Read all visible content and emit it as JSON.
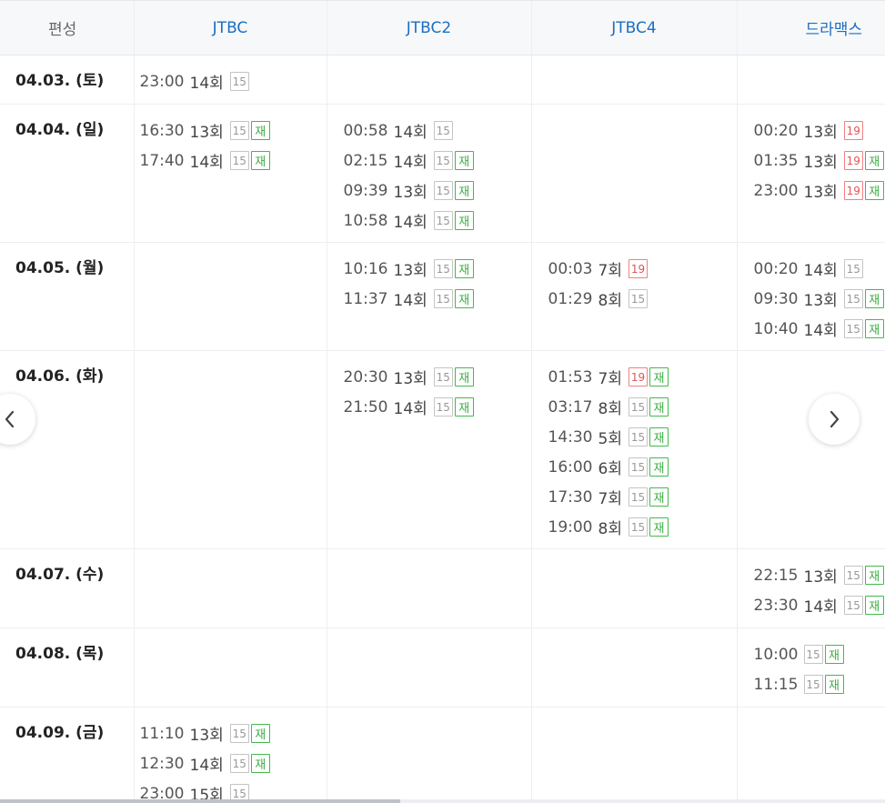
{
  "header": {
    "date_col": "편성",
    "channels": [
      "JTBC",
      "JTBC2",
      "JTBC4",
      "드라맥스"
    ]
  },
  "rows": [
    {
      "date": "04.03. (토)",
      "cells": [
        [
          {
            "time": "23:00",
            "ep": "14회",
            "rating": "15",
            "rerun": false
          }
        ],
        [],
        [],
        []
      ]
    },
    {
      "date": "04.04. (일)",
      "cells": [
        [
          {
            "time": "16:30",
            "ep": "13회",
            "rating": "15",
            "rerun": true
          },
          {
            "time": "17:40",
            "ep": "14회",
            "rating": "15",
            "rerun": true
          }
        ],
        [
          {
            "time": "00:58",
            "ep": "14회",
            "rating": "15",
            "rerun": false
          },
          {
            "time": "02:15",
            "ep": "14회",
            "rating": "15",
            "rerun": true
          },
          {
            "time": "09:39",
            "ep": "13회",
            "rating": "15",
            "rerun": true
          },
          {
            "time": "10:58",
            "ep": "14회",
            "rating": "15",
            "rerun": true
          }
        ],
        [],
        [
          {
            "time": "00:20",
            "ep": "13회",
            "rating": "19",
            "rerun": false
          },
          {
            "time": "01:35",
            "ep": "13회",
            "rating": "19",
            "rerun": true
          },
          {
            "time": "23:00",
            "ep": "13회",
            "rating": "19",
            "rerun": true
          }
        ]
      ]
    },
    {
      "date": "04.05. (월)",
      "cells": [
        [],
        [
          {
            "time": "10:16",
            "ep": "13회",
            "rating": "15",
            "rerun": true
          },
          {
            "time": "11:37",
            "ep": "14회",
            "rating": "15",
            "rerun": true
          }
        ],
        [
          {
            "time": "00:03",
            "ep": "7회",
            "rating": "19",
            "rerun": false
          },
          {
            "time": "01:29",
            "ep": "8회",
            "rating": "15",
            "rerun": false
          }
        ],
        [
          {
            "time": "00:20",
            "ep": "14회",
            "rating": "15",
            "rerun": false
          },
          {
            "time": "09:30",
            "ep": "13회",
            "rating": "15",
            "rerun": true
          },
          {
            "time": "10:40",
            "ep": "14회",
            "rating": "15",
            "rerun": true
          }
        ]
      ]
    },
    {
      "date": "04.06. (화)",
      "cells": [
        [],
        [
          {
            "time": "20:30",
            "ep": "13회",
            "rating": "15",
            "rerun": true
          },
          {
            "time": "21:50",
            "ep": "14회",
            "rating": "15",
            "rerun": true
          }
        ],
        [
          {
            "time": "01:53",
            "ep": "7회",
            "rating": "19",
            "rerun": true
          },
          {
            "time": "03:17",
            "ep": "8회",
            "rating": "15",
            "rerun": true
          },
          {
            "time": "14:30",
            "ep": "5회",
            "rating": "15",
            "rerun": true
          },
          {
            "time": "16:00",
            "ep": "6회",
            "rating": "15",
            "rerun": true
          },
          {
            "time": "17:30",
            "ep": "7회",
            "rating": "15",
            "rerun": true
          },
          {
            "time": "19:00",
            "ep": "8회",
            "rating": "15",
            "rerun": true
          }
        ],
        []
      ]
    },
    {
      "date": "04.07. (수)",
      "cells": [
        [],
        [],
        [],
        [
          {
            "time": "22:15",
            "ep": "13회",
            "rating": "15",
            "rerun": true
          },
          {
            "time": "23:30",
            "ep": "14회",
            "rating": "15",
            "rerun": true
          }
        ]
      ]
    },
    {
      "date": "04.08. (목)",
      "cells": [
        [],
        [],
        [],
        [
          {
            "time": "10:00",
            "ep": "",
            "rating": "15",
            "rerun": true
          },
          {
            "time": "11:15",
            "ep": "",
            "rating": "15",
            "rerun": true
          }
        ]
      ]
    },
    {
      "date": "04.09. (금)",
      "cells": [
        [
          {
            "time": "11:10",
            "ep": "13회",
            "rating": "15",
            "rerun": true
          },
          {
            "time": "12:30",
            "ep": "14회",
            "rating": "15",
            "rerun": true
          },
          {
            "time": "23:00",
            "ep": "15회",
            "rating": "15",
            "rerun": false
          }
        ],
        [],
        [],
        []
      ]
    }
  ],
  "labels": {
    "rerun": "재"
  },
  "icons": {
    "prev": "chevron-left-icon",
    "next": "chevron-right-icon"
  }
}
